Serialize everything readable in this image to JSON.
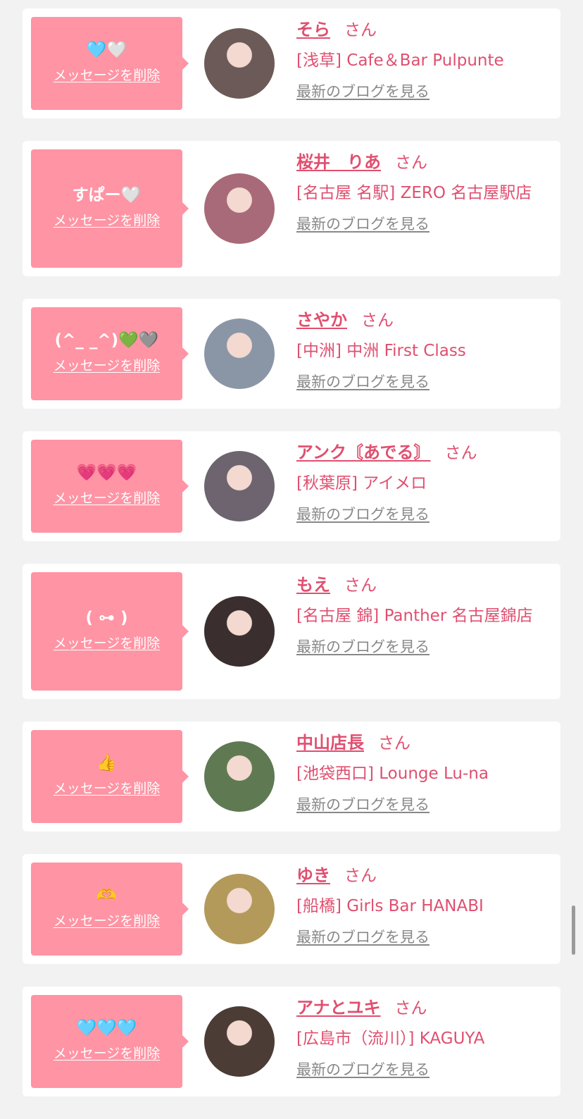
{
  "items": [
    {
      "message": "🩵🤍",
      "delete_label": "メッセージを削除",
      "name": "そら",
      "honorific": "さん",
      "shop": "[浅草] Cafe＆Bar Pulpunte",
      "blog_label": "最新のブログを見る"
    },
    {
      "message": "すぱー🤍",
      "delete_label": "メッセージを削除",
      "name": "桜井　りあ",
      "honorific": "さん",
      "shop": "[名古屋 名駅] ZERO 名古屋駅店",
      "blog_label": "最新のブログを見る"
    },
    {
      "message": "(^_ _^)💚🩶",
      "delete_label": "メッセージを削除",
      "name": "さやか",
      "honorific": "さん",
      "shop": "[中洲] 中洲 First Class",
      "blog_label": "最新のブログを見る"
    },
    {
      "message": "💗💗💗",
      "delete_label": "メッセージを削除",
      "name": "アンク〘あでる〙",
      "honorific": "さん",
      "shop": "[秋葉原] アイメロ",
      "blog_label": "最新のブログを見る"
    },
    {
      "message": "( ⊶ )",
      "delete_label": "メッセージを削除",
      "name": "もえ",
      "honorific": "さん",
      "shop": "[名古屋 錦] Panther 名古屋錦店",
      "blog_label": "最新のブログを見る"
    },
    {
      "message": "👍",
      "delete_label": "メッセージを削除",
      "name": "中山店長",
      "honorific": "さん",
      "shop": "[池袋西口] Lounge Lu-na",
      "blog_label": "最新のブログを見る"
    },
    {
      "message": "🫶",
      "delete_label": "メッセージを削除",
      "name": "ゆき",
      "honorific": "さん",
      "shop": "[船橋] Girls Bar HANABI",
      "blog_label": "最新のブログを見る"
    },
    {
      "message": "🩵🩵🩵",
      "delete_label": "メッセージを削除",
      "name": "アナとユキ",
      "honorific": "さん",
      "shop": "[広島市（流川）] KAGUYA",
      "blog_label": "最新のブログを見る"
    }
  ],
  "avatar_colors": [
    "#6b5a58",
    "#a86a78",
    "#8a96a6",
    "#6d6470",
    "#3a2f2e",
    "#5f7a52",
    "#b39a5a",
    "#4b3c36"
  ],
  "colors": {
    "accent": "#e04f6f",
    "bubble": "#ff94a4",
    "link_gray": "#888888",
    "background": "#f2f2f2"
  }
}
